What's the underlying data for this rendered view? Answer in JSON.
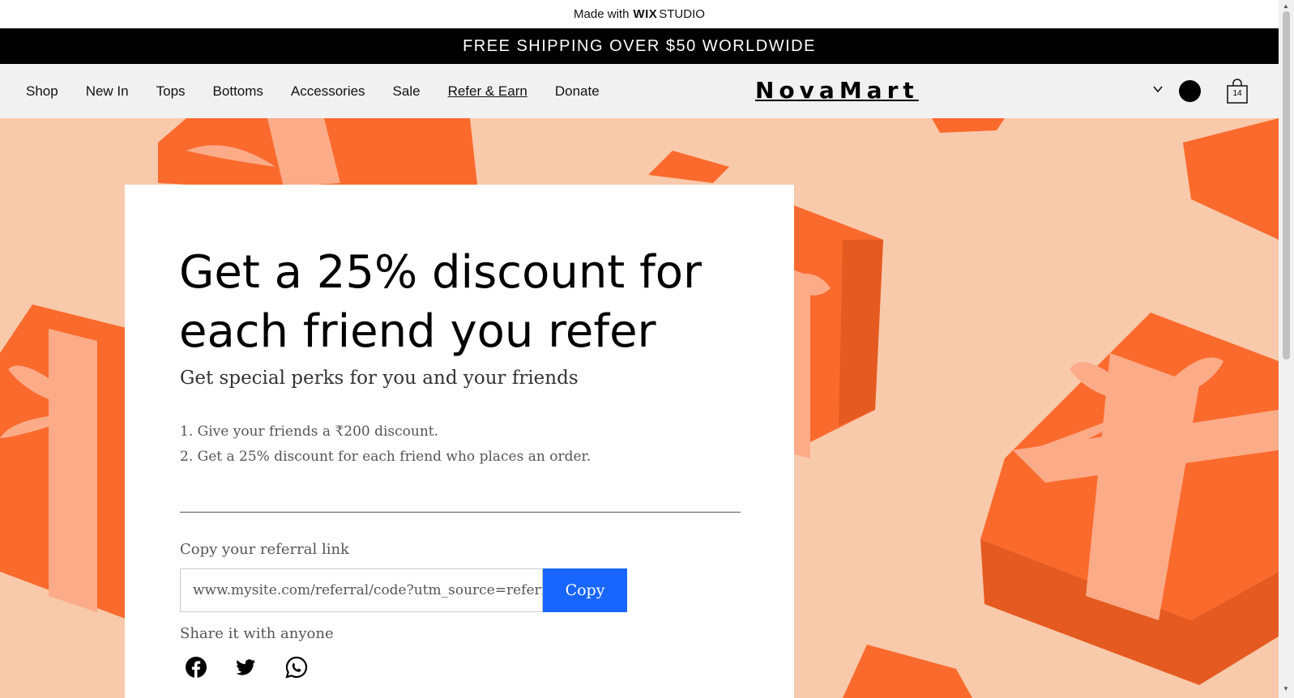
{
  "wix_banner": {
    "prefix": "Made with",
    "brand": "WIX",
    "suffix": "STUDIO"
  },
  "promo": {
    "text": "FREE SHIPPING OVER $50 WORLDWIDE"
  },
  "nav": {
    "items": [
      {
        "label": "Shop"
      },
      {
        "label": "New In"
      },
      {
        "label": "Tops"
      },
      {
        "label": "Bottoms"
      },
      {
        "label": "Accessories"
      },
      {
        "label": "Sale"
      },
      {
        "label": "Refer & Earn",
        "active": true
      },
      {
        "label": "Donate"
      }
    ],
    "logo": "NovaMart",
    "cart_count": "14"
  },
  "card": {
    "headline": "Get a 25% discount for each friend you refer",
    "subtitle": "Get special perks for you and your friends",
    "steps": [
      "1. Give your friends a ₹200 discount.",
      "2. Get a 25% discount for each friend who places an order."
    ],
    "copy_label": "Copy your referral link",
    "referral_link": "www.mysite.com/referral/code?utm_source=referral_...",
    "copy_button": "Copy",
    "share_label": "Share it with anyone"
  },
  "icons": [
    "chevron-down-icon",
    "avatar",
    "cart-icon",
    "facebook-icon",
    "twitter-icon",
    "whatsapp-icon"
  ],
  "colors": {
    "promo_bg": "#000000",
    "hero_bg": "#f9c9ab",
    "gift_box": "#fa6a2d",
    "ribbon": "#fbab88",
    "copy_button": "#1866ff"
  }
}
